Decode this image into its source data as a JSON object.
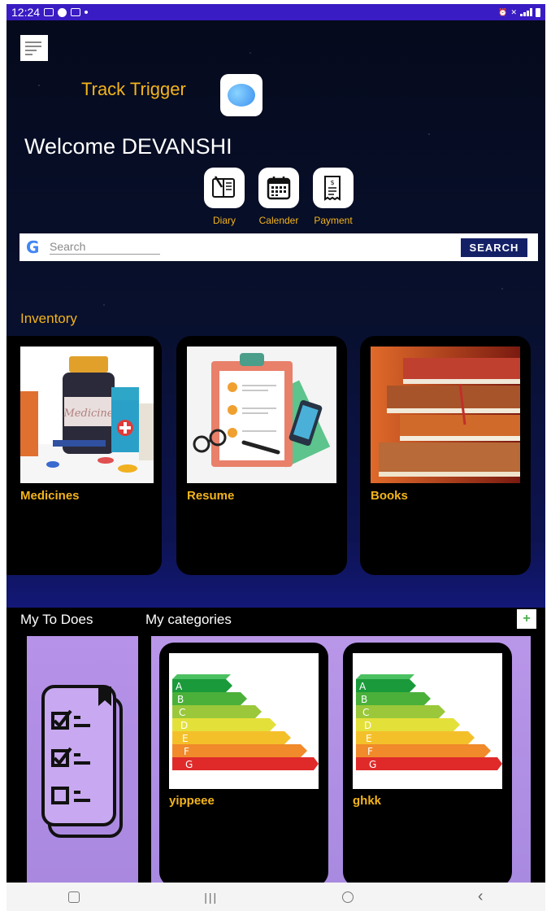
{
  "status_bar": {
    "time": "12:24"
  },
  "header": {
    "app_title": "Track Trigger",
    "welcome_prefix": "Welcome",
    "user_name": "DEVANSHI"
  },
  "quick_actions": [
    {
      "label": "Diary",
      "icon": "diary-icon"
    },
    {
      "label": "Calender",
      "icon": "calendar-icon"
    },
    {
      "label": "Payment",
      "icon": "receipt-icon"
    }
  ],
  "search": {
    "placeholder": "Search",
    "button_label": "SEARCH"
  },
  "inventory": {
    "heading": "Inventory",
    "cards": [
      {
        "label": "Medicines",
        "image": "medicine-bottles-image",
        "image_text": "Medicine"
      },
      {
        "label": "Resume",
        "image": "clipboard-resume-image"
      },
      {
        "label": "Books",
        "image": "book-stack-image"
      }
    ]
  },
  "todos": {
    "heading": "My To Does"
  },
  "categories": {
    "heading": "My categories",
    "add_label": "+",
    "energy_letters": [
      "A",
      "B",
      "C",
      "D",
      "E",
      "F",
      "G"
    ],
    "items": [
      {
        "label": "yippeee",
        "image": "energy-rating-image"
      },
      {
        "label": "ghkk",
        "image": "energy-rating-image"
      }
    ]
  },
  "colors": {
    "accent": "#f3b41c",
    "status_bar": "#3a1cc4",
    "search_button": "#142066",
    "panel": "#b18fe6"
  }
}
